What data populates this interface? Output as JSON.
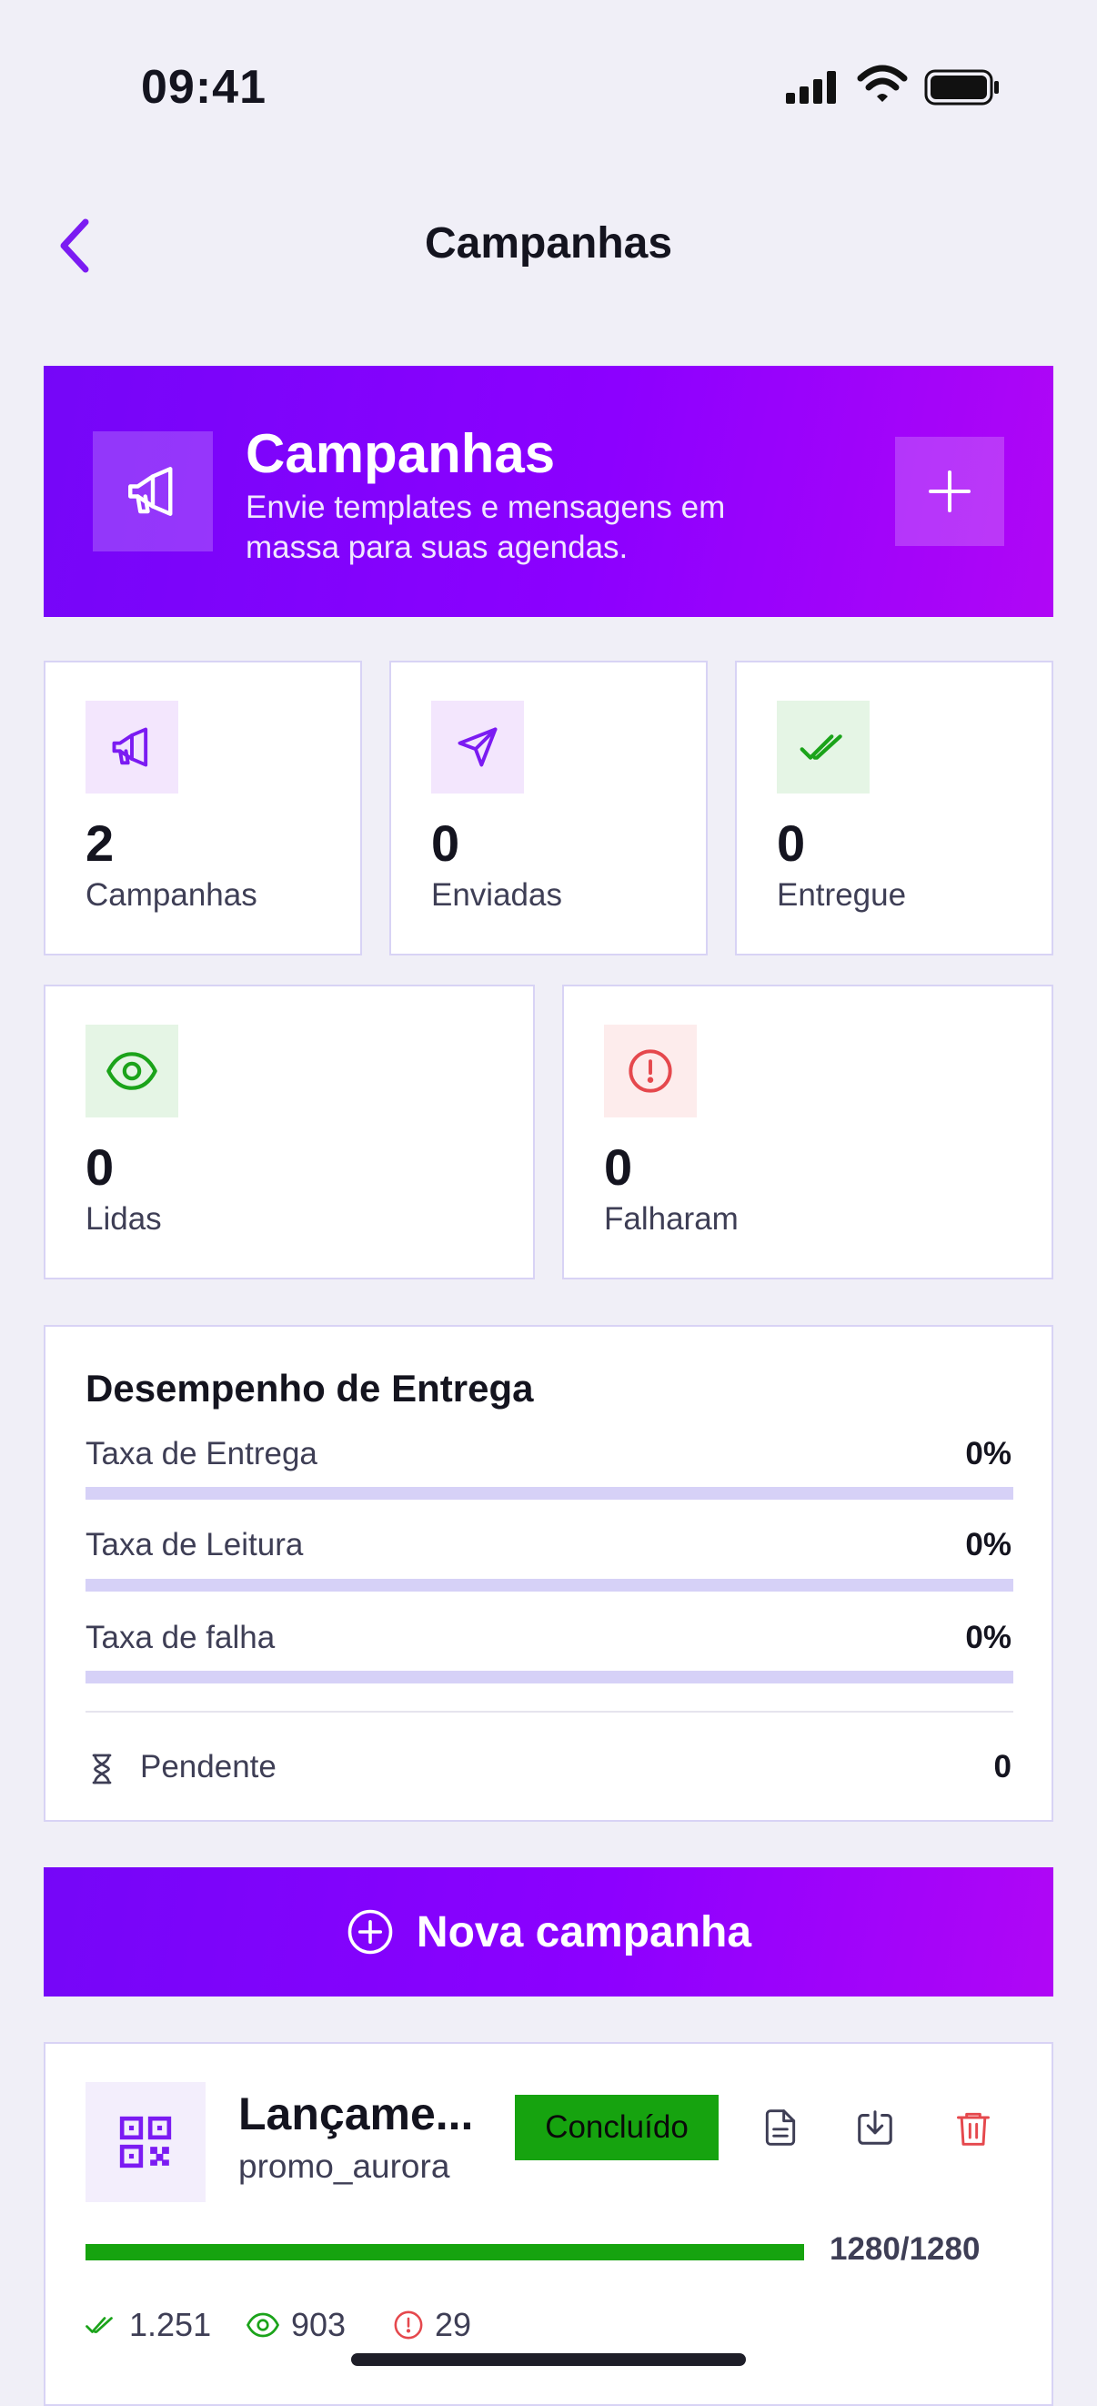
{
  "status_bar": {
    "time": "09:41"
  },
  "nav": {
    "title": "Campanhas"
  },
  "hero": {
    "title": "Campanhas",
    "subtitle": "Envie templates e mensagens em massa para suas agendas."
  },
  "stats": [
    {
      "value": "2",
      "label": "Campanhas"
    },
    {
      "value": "0",
      "label": "Enviadas"
    },
    {
      "value": "0",
      "label": "Entregue"
    },
    {
      "value": "0",
      "label": "Lidas"
    },
    {
      "value": "0",
      "label": "Falharam"
    }
  ],
  "performance": {
    "title": "Desempenho de Entrega",
    "rows": [
      {
        "label": "Taxa de Entrega",
        "value": "0%"
      },
      {
        "label": "Taxa de Leitura",
        "value": "0%"
      },
      {
        "label": "Taxa de falha",
        "value": "0%"
      }
    ],
    "pending_label": "Pendente",
    "pending_value": "0"
  },
  "new_campaign_button": {
    "label": "Nova campanha"
  },
  "campaigns": [
    {
      "name": "Lançame...",
      "template": "promo_aurora",
      "status": "Concluído",
      "progress_text": "1280/1280",
      "progress_fraction": 1.0,
      "delivered": "1.251",
      "read": "903",
      "failed": "29"
    }
  ],
  "colors": {
    "brand": "#8C00FF",
    "success": "#16A30F",
    "danger": "#E5484D",
    "background": "#F0EFF7"
  }
}
